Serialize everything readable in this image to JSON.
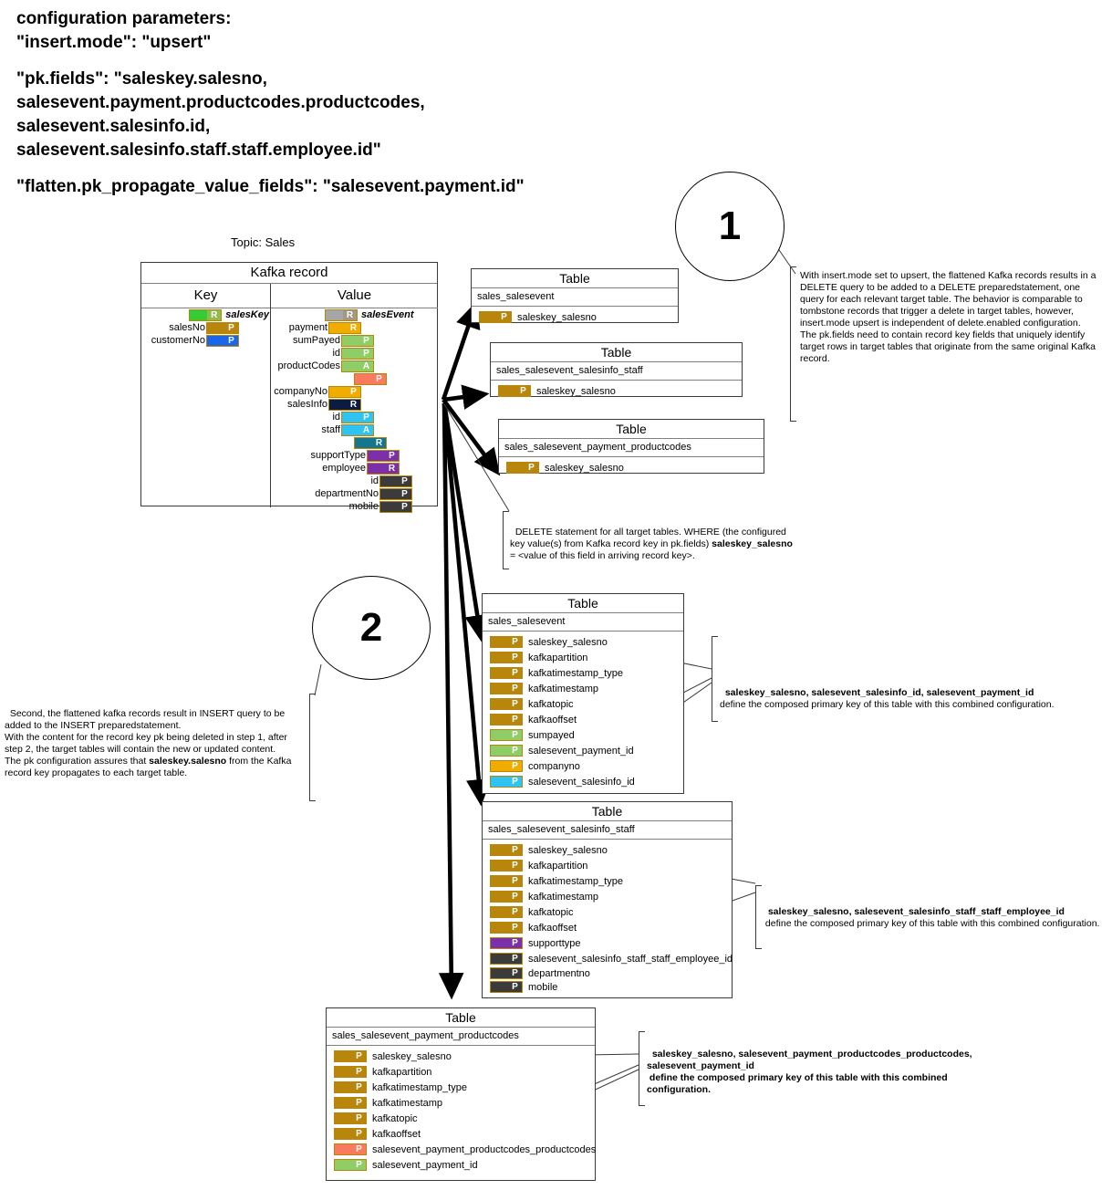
{
  "config": {
    "lines": [
      "configuration parameters:",
      "\"insert.mode\": \"upsert\"",
      "",
      "\"pk.fields\": \"saleskey.salesno,",
      "salesevent.payment.productcodes.productcodes,",
      "salesevent.salesinfo.id,",
      "salesevent.salesinfo.staff.staff.employee.id\"",
      "",
      "\"flatten.pk_propagate_value_fields\": \"salesevent.payment.id\""
    ]
  },
  "topic_label": "Topic: Sales",
  "kafka_record": {
    "title": "Kafka record",
    "key_header": "Key",
    "value_header": "Value",
    "key_rows": [
      {
        "label": "",
        "badge": "R",
        "name": "salesKey",
        "color": "#33cc33",
        "badge_color": "#8fbc4a",
        "indent": 49
      },
      {
        "label": "salesNo",
        "badge": "P",
        "name": "",
        "color": "#b8860b",
        "badge_color": "#b8860b",
        "indent": 0
      },
      {
        "label": "customerNo",
        "badge": "P",
        "name": "",
        "color": "#1a66e8",
        "badge_color": "#1a66e8",
        "indent": 0
      }
    ],
    "value_rows": [
      {
        "label": "",
        "badge": "R",
        "name": "salesEvent",
        "color": "#a6a6a6",
        "badge_color": "#a39886",
        "indent": 58
      },
      {
        "label": "payment",
        "badge": "R",
        "name": "",
        "color": "#f0ad00",
        "badge_color": "#f0ad00",
        "indent": 62
      },
      {
        "label": "sumPayed",
        "badge": "P",
        "name": "",
        "color": "#8fce66",
        "badge_color": "#8fce66",
        "indent": 76
      },
      {
        "label": "id",
        "badge": "P",
        "name": "",
        "color": "#8fce66",
        "badge_color": "#8fce66",
        "indent": 76
      },
      {
        "label": "productCodes",
        "badge": "A",
        "name": "",
        "color": "#8fce66",
        "badge_color": "#8fce66",
        "indent": 76
      },
      {
        "label": "",
        "badge": "P",
        "name": "",
        "color": "#f97a5e",
        "badge_color": "#f97a5e",
        "indent": 90
      },
      {
        "label": "companyNo",
        "badge": "P",
        "name": "",
        "color": "#f0ad00",
        "badge_color": "#f0ad00",
        "indent": 62
      },
      {
        "label": "salesInfo",
        "badge": "R",
        "name": "",
        "color": "#0a1c44",
        "badge_color": "#0a1c44",
        "indent": 62
      },
      {
        "label": "id",
        "badge": "P",
        "name": "",
        "color": "#2ec3f0",
        "badge_color": "#2ec3f0",
        "indent": 76
      },
      {
        "label": "staff",
        "badge": "A",
        "name": "",
        "color": "#2ec3f0",
        "badge_color": "#2ec3f0",
        "indent": 76
      },
      {
        "label": "",
        "badge": "R",
        "name": "",
        "color": "#15778f",
        "badge_color": "#15778f",
        "indent": 90
      },
      {
        "label": "supportType",
        "badge": "P",
        "name": "",
        "color": "#7b2fa8",
        "badge_color": "#7b2fa8",
        "indent": 104
      },
      {
        "label": "employee",
        "badge": "R",
        "name": "",
        "color": "#7b2fa8",
        "badge_color": "#7b2fa8",
        "indent": 104
      },
      {
        "label": "id",
        "badge": "P",
        "name": "",
        "color": "#3b3b3b",
        "badge_color": "#3b3b3b",
        "indent": 118
      },
      {
        "label": "departmentNo",
        "badge": "P",
        "name": "",
        "color": "#3b3b3b",
        "badge_color": "#3b3b3b",
        "indent": 118
      },
      {
        "label": "mobile",
        "badge": "P",
        "name": "",
        "color": "#3b3b3b",
        "badge_color": "#3b3b3b",
        "indent": 118
      }
    ]
  },
  "table_word": "Table",
  "delete_tables": [
    {
      "name": "sales_salesevent",
      "fields": [
        {
          "badge": "P",
          "label": "saleskey_salesno",
          "color": "#b8860b"
        }
      ]
    },
    {
      "name": "sales_salesevent_salesinfo_staff",
      "fields": [
        {
          "badge": "P",
          "label": "saleskey_salesno",
          "color": "#b8860b"
        }
      ]
    },
    {
      "name": "sales_salesevent_payment_productcodes",
      "fields": [
        {
          "badge": "P",
          "label": "saleskey_salesno",
          "color": "#b8860b"
        }
      ]
    }
  ],
  "insert_tables": [
    {
      "name": "sales_salesevent",
      "fields": [
        {
          "badge": "P",
          "label": "saleskey_salesno",
          "color": "#b8860b"
        },
        {
          "badge": "P",
          "label": "kafkapartition",
          "color": "#b8860b"
        },
        {
          "badge": "P",
          "label": "kafkatimestamp_type",
          "color": "#b8860b"
        },
        {
          "badge": "P",
          "label": "kafkatimestamp",
          "color": "#b8860b"
        },
        {
          "badge": "P",
          "label": "kafkatopic",
          "color": "#b8860b"
        },
        {
          "badge": "P",
          "label": "kafkaoffset",
          "color": "#b8860b"
        },
        {
          "badge": "P",
          "label": "sumpayed",
          "color": "#8fce66"
        },
        {
          "badge": "P",
          "label": "salesevent_payment_id",
          "color": "#8fce66"
        },
        {
          "badge": "P",
          "label": "companyno",
          "color": "#f0ad00"
        },
        {
          "badge": "P",
          "label": "salesevent_salesinfo_id",
          "color": "#2ec3f0"
        }
      ]
    },
    {
      "name": "sales_salesevent_salesinfo_staff",
      "fields": [
        {
          "badge": "P",
          "label": "saleskey_salesno",
          "color": "#b8860b"
        },
        {
          "badge": "P",
          "label": "kafkapartition",
          "color": "#b8860b"
        },
        {
          "badge": "P",
          "label": "kafkatimestamp_type",
          "color": "#b8860b"
        },
        {
          "badge": "P",
          "label": "kafkatimestamp",
          "color": "#b8860b"
        },
        {
          "badge": "P",
          "label": "kafkatopic",
          "color": "#b8860b"
        },
        {
          "badge": "P",
          "label": "kafkaoffset",
          "color": "#b8860b"
        },
        {
          "badge": "P",
          "label": "supporttype",
          "color": "#7b2fa8"
        },
        {
          "badge": "P",
          "label": "salesevent_salesinfo_staff_staff_employee_id",
          "color": "#3b3b3b"
        },
        {
          "badge": "P",
          "label": "departmentno",
          "color": "#3b3b3b"
        },
        {
          "badge": "P",
          "label": "mobile",
          "color": "#3b3b3b"
        }
      ]
    },
    {
      "name": "sales_salesevent_payment_productcodes",
      "fields": [
        {
          "badge": "P",
          "label": "saleskey_salesno",
          "color": "#b8860b"
        },
        {
          "badge": "P",
          "label": "kafkapartition",
          "color": "#b8860b"
        },
        {
          "badge": "P",
          "label": "kafkatimestamp_type",
          "color": "#b8860b"
        },
        {
          "badge": "P",
          "label": "kafkatimestamp",
          "color": "#b8860b"
        },
        {
          "badge": "P",
          "label": "kafkatopic",
          "color": "#b8860b"
        },
        {
          "badge": "P",
          "label": "kafkaoffset",
          "color": "#b8860b"
        },
        {
          "badge": "P",
          "label": "salesevent_payment_productcodes_productcodes",
          "color": "#f97a5e"
        },
        {
          "badge": "P",
          "label": "salesevent_payment_id",
          "color": "#8fce66"
        }
      ]
    }
  ],
  "markers": {
    "one": "1",
    "two": "2"
  },
  "notes": {
    "step1": "With insert.mode set to upsert, the flattened Kafka records results in a DELETE query to be added to a DELETE preparedstatement, one query for each relevant target table. The behavior is comparable to tombstone records that trigger a delete in target tables, however, insert.mode upsert is independent of delete.enabled configuration. The pk.fields need to contain record key fields that uniquely identify target rows in target tables that originate from the same original Kafka record.",
    "delete_stmt_plain1": "DELETE statement for all target tables. WHERE (the configured key value(s) from Kafka record key in pk.fields) ",
    "delete_stmt_bold": "saleskey_salesno",
    "delete_stmt_plain2": " = <value of this field in arriving record key>.",
    "step2_plain1": "Second, the flattened kafka records result in INSERT query to be added to the INSERT preparedstatement.\nWith the content for the record key pk being deleted in step 1, after step 2, the target tables will contain the new or updated content.\nThe pk configuration assures that ",
    "step2_bold": "saleskey.salesno",
    "step2_plain2": " from the Kafka record key propagates to each target table.",
    "pk_note_1_bold": "saleskey_salesno, salesevent_salesinfo_id, salesevent_payment_id",
    "pk_note_1_plain": "\ndefine the composed primary key of this table with this combined configuration.",
    "pk_note_2_bold": "saleskey_salesno, salesevent_salesinfo_staff_staff_employee_id",
    "pk_note_2_plain": "\n define the composed primary key of this table with this combined configuration.",
    "pk_note_3_bold": "saleskey_salesno, salesevent_payment_productcodes_productcodes,\nsalesevent_payment_id",
    "pk_note_3_plain": "\n define the composed primary key of this table with this combined\nconfiguration."
  }
}
